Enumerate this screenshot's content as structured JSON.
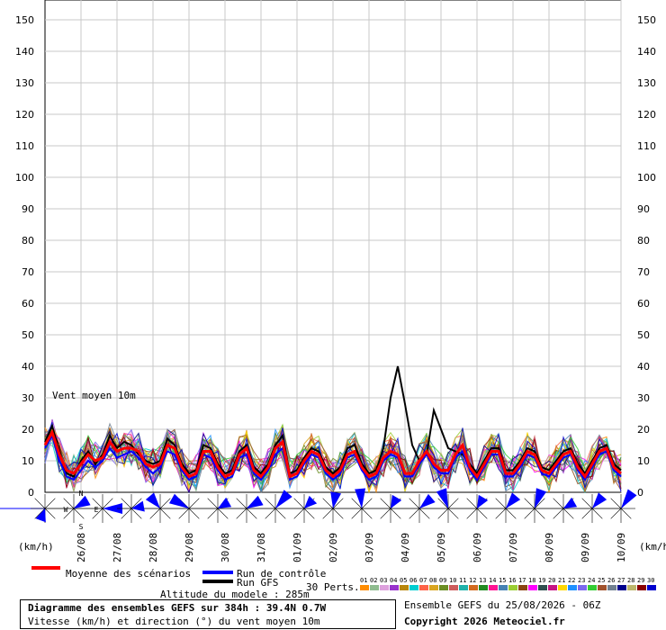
{
  "chart_data": {
    "type": "line",
    "title": "Diagramme des ensembles GEFS sur 384h : 39.4N 0.7W",
    "subtitle": "Vitesse (km/h) et direction (°) du vent moyen 10m",
    "annotation": "Vent moyen 10m",
    "ylabel_left": "(km/h)",
    "ylabel_right": "(km/h)",
    "ylim": [
      0,
      150
    ],
    "yticks": [
      0,
      10,
      20,
      30,
      40,
      50,
      60,
      70,
      80,
      90,
      100,
      110,
      120,
      130,
      140,
      150
    ],
    "x_date_labels": [
      "26/08",
      "27/08",
      "28/08",
      "29/08",
      "30/08",
      "31/08",
      "01/09",
      "02/09",
      "03/09",
      "04/09",
      "05/09",
      "06/09",
      "07/09",
      "08/09",
      "09/09",
      "10/09"
    ],
    "x_step_hours": 6,
    "grid": true,
    "series": [
      {
        "name": "Moyenne des scénarios",
        "color": "#ff0000",
        "values": [
          15,
          19,
          12,
          7,
          6,
          9,
          12,
          10,
          11,
          16,
          13,
          14,
          14,
          13,
          9,
          8,
          9,
          15,
          14,
          8,
          5,
          6,
          13,
          13,
          8,
          5,
          6,
          12,
          14,
          7,
          5,
          8,
          14,
          16,
          5,
          6,
          10,
          13,
          12,
          7,
          5,
          7,
          12,
          13,
          8,
          5,
          6,
          11,
          13,
          12,
          6,
          6,
          10,
          13,
          9,
          7,
          7,
          12,
          15,
          8,
          5,
          9,
          13,
          13,
          6,
          6,
          9,
          13,
          12,
          7,
          6,
          9,
          12,
          13,
          8,
          5,
          9,
          13,
          14,
          8,
          6
        ]
      },
      {
        "name": "Run de contrôle",
        "color": "#0000ff",
        "values": [
          14,
          18,
          10,
          5,
          4,
          7,
          10,
          8,
          10,
          14,
          11,
          12,
          13,
          11,
          8,
          6,
          8,
          13,
          12,
          7,
          4,
          5,
          12,
          11,
          7,
          4,
          5,
          11,
          12,
          6,
          4,
          7,
          12,
          14,
          4,
          5,
          9,
          12,
          11,
          6,
          4,
          6,
          11,
          12,
          7,
          4,
          5,
          10,
          12,
          11,
          5,
          5,
          9,
          12,
          8,
          6,
          6,
          11,
          13,
          7,
          4,
          8,
          12,
          12,
          5,
          5,
          8,
          12,
          11,
          6,
          5,
          8,
          11,
          12,
          7,
          4,
          8,
          12,
          13,
          7,
          5
        ]
      },
      {
        "name": "Run GFS",
        "color": "#000000",
        "values": [
          16,
          21,
          13,
          6,
          5,
          10,
          13,
          9,
          12,
          18,
          14,
          16,
          15,
          12,
          10,
          9,
          10,
          17,
          15,
          9,
          6,
          7,
          15,
          14,
          9,
          6,
          7,
          13,
          15,
          8,
          6,
          9,
          15,
          18,
          6,
          7,
          11,
          14,
          13,
          8,
          6,
          8,
          14,
          15,
          9,
          6,
          7,
          14,
          30,
          40,
          28,
          15,
          10,
          12,
          26,
          20,
          14,
          13,
          12,
          9,
          6,
          10,
          14,
          14,
          7,
          7,
          10,
          14,
          13,
          8,
          7,
          10,
          13,
          14,
          9,
          6,
          10,
          14,
          15,
          9,
          7
        ]
      }
    ]
  },
  "legend": {
    "mean_label": "Moyenne des scénarios",
    "control_label": "Run de contrôle",
    "gfs_label": "Run GFS",
    "perts_label": "30 Perts.",
    "pert_numbers": [
      "01",
      "02",
      "03",
      "04",
      "05",
      "06",
      "07",
      "08",
      "09",
      "10",
      "11",
      "12",
      "13",
      "14",
      "15",
      "16",
      "17",
      "18",
      "19",
      "20",
      "21",
      "22",
      "23",
      "24",
      "25",
      "26",
      "27",
      "28",
      "29",
      "30"
    ],
    "pert_colors": [
      "#ff8c00",
      "#8fbc8f",
      "#dda0dd",
      "#9932cc",
      "#b8860b",
      "#00ced1",
      "#ff6347",
      "#daa520",
      "#6b8e23",
      "#cd5c5c",
      "#20b2aa",
      "#d2691e",
      "#228b22",
      "#ff1493",
      "#4682b4",
      "#9acd32",
      "#8b4513",
      "#ff00ff",
      "#2f4f4f",
      "#c71585",
      "#ffd700",
      "#1e90ff",
      "#7b68ee",
      "#32cd32",
      "#a0522d",
      "#708090",
      "#00008b",
      "#bdb76b",
      "#8b0000",
      "#0000cd"
    ]
  },
  "wind_rose": {
    "north": "N",
    "south": "S",
    "east": "E",
    "west": "W"
  },
  "info": {
    "altitude": "Altitude du modele : 285m",
    "ensemble": "Ensemble GEFS du 25/08/2026 - 06Z",
    "copyright": "Copyright 2026 Meteociel.fr"
  },
  "colors": {
    "grid": "#c8c8c8",
    "rose": "#0000ff"
  }
}
